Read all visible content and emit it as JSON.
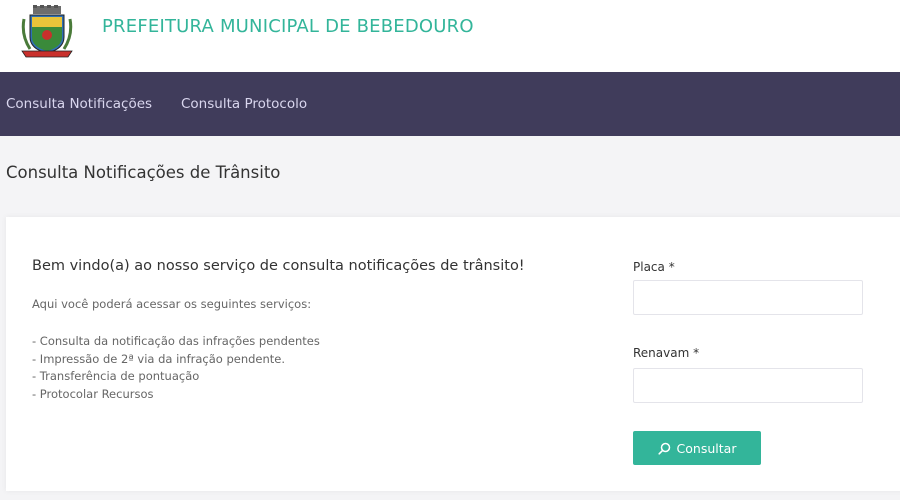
{
  "header": {
    "title": "PREFEITURA MUNICIPAL DE BEBEDOURO",
    "logo_icon": "municipal-coat-of-arms-icon"
  },
  "nav": {
    "items": [
      {
        "label": "Consulta Notificações"
      },
      {
        "label": "Consulta Protocolo"
      }
    ]
  },
  "main": {
    "page_title": "Consulta Notificações de Trânsito",
    "welcome": "Bem vindo(a) ao nosso serviço de consulta notificações de trânsito!",
    "intro": "Aqui você poderá acessar os seguintes serviços:",
    "services": [
      "- Consulta da notificação das infrações pendentes",
      "- Impressão de 2ª via da infração pendente.",
      "- Transferência de pontuação",
      "- Protocolar Recursos"
    ]
  },
  "form": {
    "placa_label": "Placa *",
    "placa_value": "",
    "renavam_label": "Renavam *",
    "renavam_value": "",
    "submit_label": "Consultar",
    "submit_icon": "search-icon"
  },
  "colors": {
    "accent": "#33b59a",
    "navbar": "#403c5b",
    "nav_text": "#d9d6ee"
  }
}
